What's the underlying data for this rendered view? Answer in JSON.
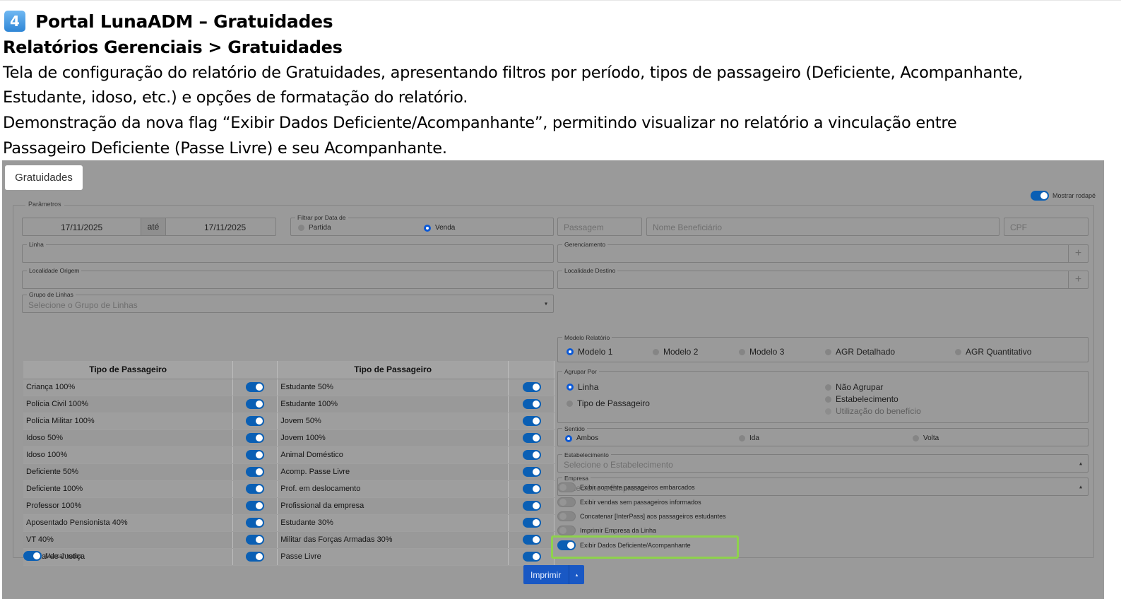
{
  "doc": {
    "badge": "4",
    "title": "Portal LunaADM – Gratuidades",
    "breadcrumb": "Relatórios Gerenciais > Gratuidades",
    "para_lines": [
      "Tela de configuração do relatório de Gratuidades, apresentando filtros por período, tipos de passageiro (Deficiente, Acompanhante,",
      "Estudante, idoso, etc.) e opções de formatação do relatório.",
      "Demonstração da nova flag “Exibir Dados Deficiente/Acompanhante”, permitindo visualizar no relatório a vinculação entre",
      "Passageiro Deficiente (Passe Livre) e seu Acompanhante."
    ]
  },
  "app": {
    "tab_label": "Gratuidades",
    "mostrar_rodape": "Mostrar rodapé",
    "params_legend": "Parâmetros",
    "date_from": "17/11/2025",
    "ate": "até",
    "date_to": "17/11/2025",
    "filtrar_label": "Filtrar por Data de",
    "partida": "Partida",
    "venda": "Venda",
    "passagem_ph": "Passagem",
    "nome_ph": "Nome Beneficiário",
    "cpf_ph": "CPF",
    "linha_label": "Linha",
    "gerenciamento_label": "Gerenciamento",
    "origem_label": "Localidade Origem",
    "destino_label": "Localidade Destino",
    "grupo_label": "Grupo de Linhas",
    "grupo_ph": "Selecione o Grupo de Linhas",
    "plus": "+",
    "table_header": "Tipo de Passageiro",
    "left_types": [
      "Criança 100%",
      "Polícia Civil 100%",
      "Polícia Militar 100%",
      "Idoso 50%",
      "Idoso 100%",
      "Deficiente 50%",
      "Deficiente 100%",
      "Professor 100%",
      "Aposentado Pensionista 40%",
      "VT 40%",
      "Oficial de Justiça"
    ],
    "right_types": [
      "Estudante 50%",
      "Estudante 100%",
      "Jovem 50%",
      "Jovem 100%",
      "Animal Doméstico",
      "Acomp. Passe Livre",
      "Prof. em deslocamento",
      "Profissional da empresa",
      "Estudante 30%",
      "Militar das Forças Armadas 30%",
      "Passe Livre"
    ],
    "marcar_todos": "Marcar todos",
    "modelo_label": "Modelo Relatório",
    "modelos": [
      "Modelo 1",
      "Modelo 2",
      "Modelo 3",
      "AGR Detalhado",
      "AGR Quantitativo"
    ],
    "agrupar_label": "Agrupar Por",
    "agrupar": [
      "Linha",
      "Tipo de Passageiro",
      "Não Agrupar",
      "Estabelecimento",
      "Utilização do benefício"
    ],
    "sentido_label": "Sentido",
    "sentidos": [
      "Ambos",
      "Ida",
      "Volta"
    ],
    "estab_label": "Estabelecimento",
    "estab_ph": "Selecione o Estabelecimento",
    "empresa_label": "Empresa",
    "empresa_ph": "Selecione a Empresa",
    "switches": [
      "Exibir somente passageiros embarcados",
      "Exibir vendas sem passageiros informados",
      "Concatenar [InterPass] aos passageiros estudantes",
      "Imprimir Empresa da Linha",
      "Exibir Dados Deficiente/Acompanhante"
    ],
    "imprimir": "Imprimir",
    "caret_up": "▴"
  },
  "colors": {
    "accent": "#0a5fb4",
    "highlight": "#8ed24d",
    "button": "#1958c4"
  }
}
